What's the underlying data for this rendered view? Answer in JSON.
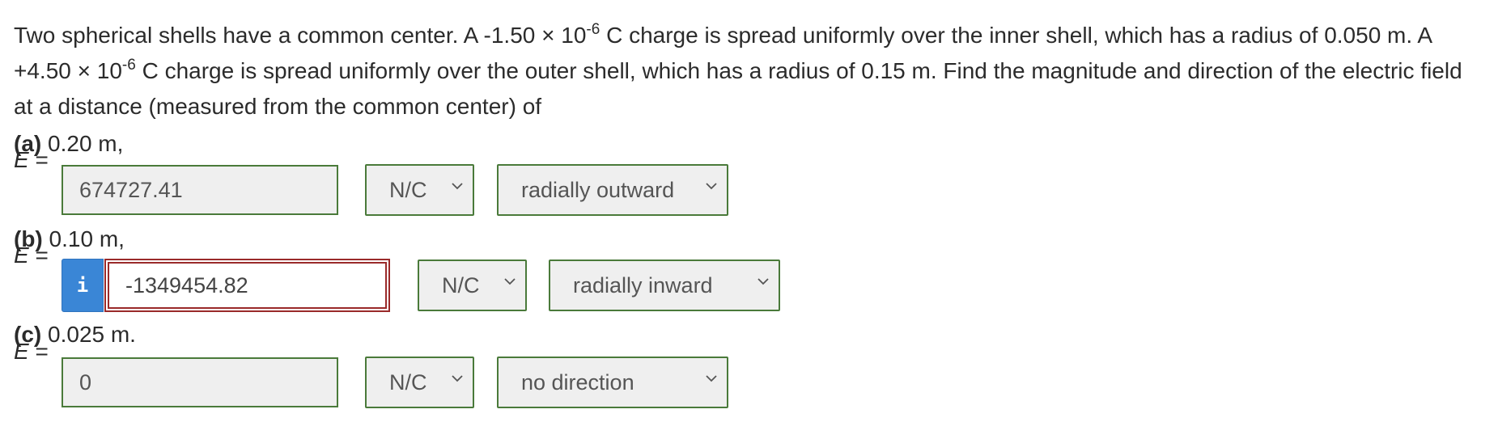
{
  "problem": {
    "intro": "Two spherical shells have a common center. A -1.50 × 10",
    "exp1": "-6",
    "mid1": " C charge is spread uniformly over the inner shell, which has a radius of 0.050 m. A +4.50 × 10",
    "exp2": "-6",
    "mid2": " C charge is spread uniformly over the outer shell, which has a radius of 0.15 m. Find the magnitude and direction of the electric field at a distance (measured from the common center) of"
  },
  "parts": [
    {
      "letter": "(a)",
      "distance": " 0.20 m,",
      "e_symbol": "E",
      "equals": " =",
      "value": "674727.41",
      "unit": "N/C",
      "direction": "radially outward"
    },
    {
      "letter": "(b)",
      "distance": " 0.10 m,",
      "e_symbol": "E",
      "equals": " =",
      "info": "i",
      "value": "-1349454.82",
      "unit": "N/C",
      "direction": "radially inward"
    },
    {
      "letter": "(c)",
      "distance": " 0.025 m.",
      "e_symbol": "E",
      "equals": " =",
      "value": "0",
      "unit": "N/C",
      "direction": "no direction"
    }
  ],
  "icons": {
    "dropdown": "chevron-down-icon",
    "info": "info-icon"
  },
  "colors": {
    "correct_border": "#4a7a3a",
    "incorrect_border": "#9a2a2a",
    "info_button": "#3a86d6",
    "field_bg": "#efefef"
  }
}
